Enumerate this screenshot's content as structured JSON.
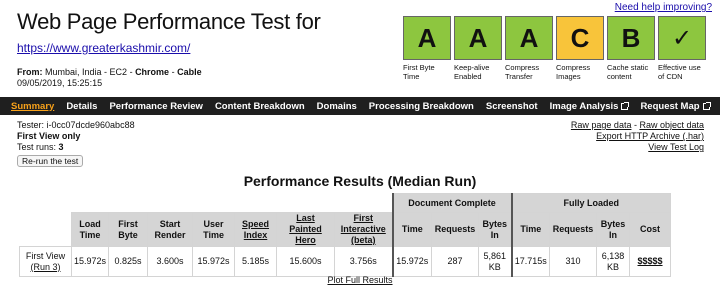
{
  "header": {
    "title": "Web Page Performance Test for",
    "url": "https://www.greaterkashmir.com/",
    "from_label": "From:",
    "location": "Mumbai, India - EC2",
    "sep": " - ",
    "browser": "Chrome",
    "connection": "Cable",
    "datetime": "09/05/2019, 15:25:15",
    "help_link": "Need help improving?"
  },
  "grades": [
    {
      "grade": "A",
      "label": "First Byte Time",
      "color": "#8dc63f"
    },
    {
      "grade": "A",
      "label": "Keep-alive Enabled",
      "color": "#8dc63f"
    },
    {
      "grade": "A",
      "label": "Compress Transfer",
      "color": "#8dc63f"
    },
    {
      "grade": "C",
      "label": "Compress Images",
      "color": "#f8c43a"
    },
    {
      "grade": "B",
      "label": "Cache static content",
      "color": "#8dc63f"
    },
    {
      "grade": "✓",
      "label": "Effective use of CDN",
      "color": "#8dc63f"
    }
  ],
  "nav": {
    "items": [
      "Summary",
      "Details",
      "Performance Review",
      "Content Breakdown",
      "Domains",
      "Processing Breakdown",
      "Screenshot",
      "Image Analysis",
      "Request Map"
    ]
  },
  "test_info": {
    "tester": "Tester: i-0cc07dcde960abc88",
    "view": "First View only",
    "runs_label": "Test runs: ",
    "runs": "3",
    "rerun": "Re-run the test"
  },
  "links": {
    "raw_page": "Raw page data",
    "sep": " - ",
    "raw_object": "Raw object data",
    "export": "Export HTTP Archive (.har)",
    "log": "View Test Log"
  },
  "results": {
    "title": "Performance Results (Median Run)",
    "groups": {
      "document_complete": "Document Complete",
      "fully_loaded": "Fully Loaded"
    },
    "headers": {
      "load_time": "Load Time",
      "first_byte": "First Byte",
      "start_render": "Start Render",
      "user_time": "User Time",
      "speed_index": "Speed Index",
      "last_painted_hero": "Last Painted Hero",
      "first_interactive": "First Interactive (beta)",
      "time": "Time",
      "requests": "Requests",
      "bytes_in": "Bytes In",
      "cost": "Cost"
    },
    "row": {
      "label": "First View",
      "run": "(Run 3)",
      "load_time": "15.972s",
      "first_byte": "0.825s",
      "start_render": "3.600s",
      "user_time": "15.972s",
      "speed_index": "5.185s",
      "last_painted_hero": "15.600s",
      "first_interactive": "3.756s",
      "dc_time": "15.972s",
      "dc_requests": "287",
      "dc_bytes": "5,861 KB",
      "fl_time": "17.715s",
      "fl_requests": "310",
      "fl_bytes": "6,138 KB",
      "cost": "$$$$$"
    },
    "plot_link": "Plot Full Results"
  }
}
